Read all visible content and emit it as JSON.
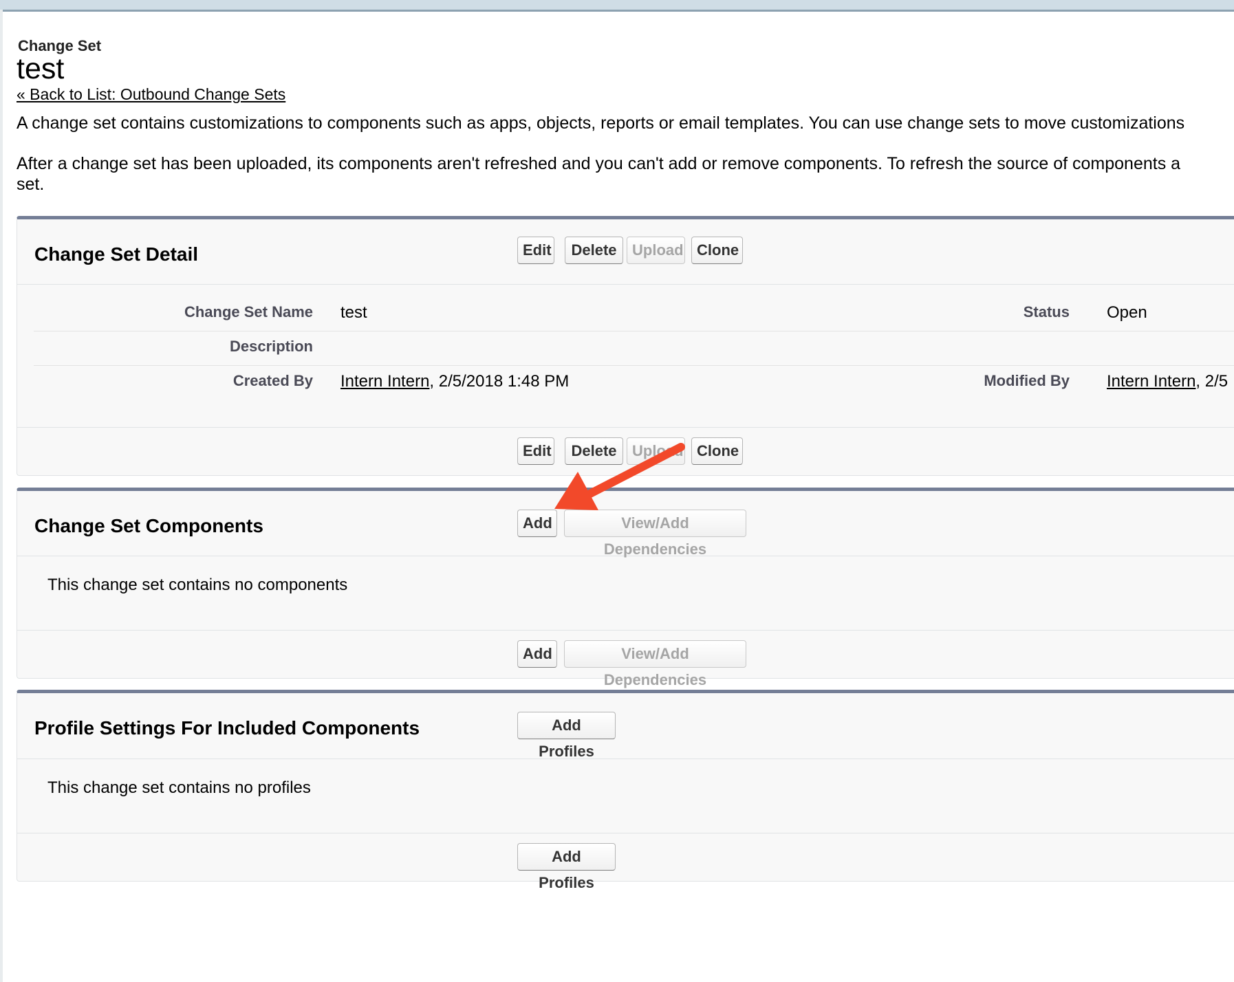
{
  "page": {
    "type_label": "Change Set",
    "title": "test",
    "back_link": "« Back to List: Outbound Change Sets",
    "description_1": "A change set contains customizations to components such as apps, objects, reports or email templates. You can use change sets to move customizations",
    "description_2": "After a change set has been uploaded, its components aren't refreshed and you can't add or remove components. To refresh the source of components a",
    "description_2b": "set."
  },
  "detail": {
    "title": "Change Set Detail",
    "buttons": {
      "edit": "Edit",
      "delete": "Delete",
      "upload": "Upload",
      "clone": "Clone"
    },
    "fields": {
      "name_label": "Change Set Name",
      "name_value": "test",
      "status_label": "Status",
      "status_value": "Open",
      "description_label": "Description",
      "created_label": "Created By",
      "created_user": "Intern Intern",
      "created_date": ", 2/5/2018 1:48 PM",
      "modified_label": "Modified By",
      "modified_user": "Intern Intern",
      "modified_date": ", 2/5"
    }
  },
  "components": {
    "title": "Change Set Components",
    "add_button": "Add",
    "deps_button": "View/Add Dependencies",
    "empty_message": "This change set contains no components"
  },
  "profiles": {
    "title": "Profile Settings For Included Components",
    "add_button": "Add Profiles",
    "empty_message": "This change set contains no profiles"
  },
  "colors": {
    "section_border": "#747e96",
    "arrow": "#f2492a",
    "disabled_text": "#a5a5a5"
  }
}
